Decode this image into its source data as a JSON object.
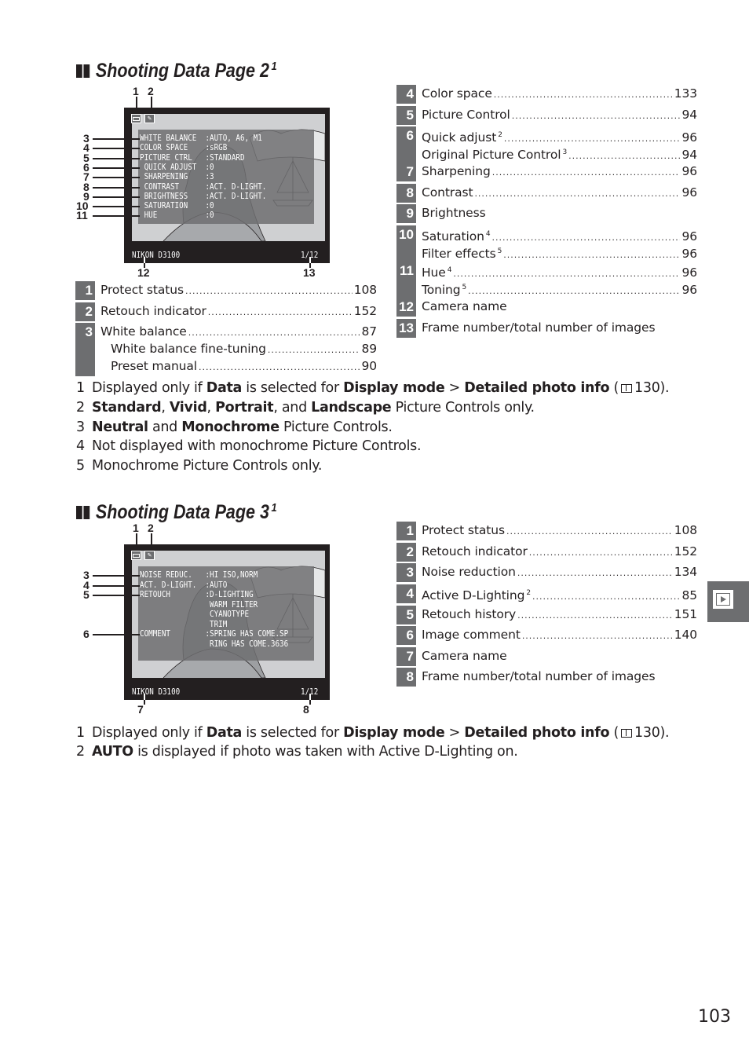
{
  "section2": {
    "title": "Shooting Data Page 2",
    "title_sup": "1",
    "screen": {
      "callouts_top": [
        "1",
        "2"
      ],
      "rows": [
        {
          "n": "3",
          "text": "WHITE BALANCE  :AUTO, A6, M1"
        },
        {
          "n": "4",
          "text": "COLOR SPACE    :sRGB"
        },
        {
          "n": "5",
          "text": "PICTURE CTRL   :STANDARD"
        },
        {
          "n": "6",
          "text": " QUICK ADJUST  :0"
        },
        {
          "n": "7",
          "text": " SHARPENING    :3"
        },
        {
          "n": "8",
          "text": " CONTRAST      :ACT. D-LIGHT."
        },
        {
          "n": "9",
          "text": " BRIGHTNESS    :ACT. D-LIGHT."
        },
        {
          "n": "10",
          "text": " SATURATION    :0"
        },
        {
          "n": "11",
          "text": " HUE           :0"
        }
      ],
      "camera_name": "NIKON D3100",
      "frame": "1/12",
      "callouts_bottom": [
        "12",
        "13"
      ]
    },
    "left_index": [
      {
        "num": "1",
        "lines": [
          {
            "label": "Protect status",
            "sup": "",
            "page": "108"
          }
        ]
      },
      {
        "num": "2",
        "lines": [
          {
            "label": "Retouch indicator",
            "sup": "",
            "page": "152"
          }
        ]
      },
      {
        "num": "3",
        "lines": [
          {
            "label": "White balance",
            "sup": "",
            "page": "87"
          },
          {
            "label": "White balance fine-tuning",
            "sup": "",
            "page": "89",
            "indent": true
          },
          {
            "label": "Preset manual",
            "sup": "",
            "page": "90",
            "indent": true
          }
        ]
      }
    ],
    "right_index": [
      {
        "num": "4",
        "lines": [
          {
            "label": "Color space",
            "sup": "",
            "page": "133"
          }
        ]
      },
      {
        "num": "5",
        "lines": [
          {
            "label": "Picture Control",
            "sup": "",
            "page": "94"
          }
        ]
      },
      {
        "num": "6",
        "lines": [
          {
            "label": "Quick adjust",
            "sup": "2",
            "page": "96"
          },
          {
            "label": "Original Picture Control",
            "sup": "3",
            "page": "94"
          }
        ]
      },
      {
        "num": "7",
        "lines": [
          {
            "label": "Sharpening",
            "sup": "",
            "page": "96"
          }
        ]
      },
      {
        "num": "8",
        "lines": [
          {
            "label": "Contrast",
            "sup": "",
            "page": "96"
          }
        ]
      },
      {
        "num": "9",
        "lines": [
          {
            "label": "Brightness",
            "sup": "",
            "page": ""
          }
        ]
      },
      {
        "num": "10",
        "lines": [
          {
            "label": "Saturation",
            "sup": "4",
            "page": "96"
          },
          {
            "label": "Filter effects",
            "sup": "5",
            "page": "96"
          }
        ]
      },
      {
        "num": "11",
        "lines": [
          {
            "label": "Hue",
            "sup": "4",
            "page": "96"
          },
          {
            "label": "Toning",
            "sup": "5",
            "page": "96"
          }
        ]
      },
      {
        "num": "12",
        "lines": [
          {
            "label": "Camera name",
            "sup": "",
            "page": ""
          }
        ]
      },
      {
        "num": "13",
        "lines": [
          {
            "label": "Frame number/total number of images",
            "sup": "",
            "page": ""
          }
        ]
      }
    ],
    "footnotes": [
      {
        "n": "1",
        "segs": [
          {
            "t": "Displayed only if "
          },
          {
            "t": "Data",
            "b": true
          },
          {
            "t": " is selected for "
          },
          {
            "t": "Display mode",
            "b": true
          },
          {
            "t": " > "
          },
          {
            "t": "Detailed photo info",
            "b": true
          },
          {
            "t": " ("
          },
          {
            "book": true
          },
          {
            "t": "130)."
          }
        ]
      },
      {
        "n": "2",
        "segs": [
          {
            "t": "Standard",
            "b": true
          },
          {
            "t": ", "
          },
          {
            "t": "Vivid",
            "b": true
          },
          {
            "t": ", "
          },
          {
            "t": "Portrait",
            "b": true
          },
          {
            "t": ", and "
          },
          {
            "t": "Landscape",
            "b": true
          },
          {
            "t": " Picture Controls only."
          }
        ]
      },
      {
        "n": "3",
        "segs": [
          {
            "t": "Neutral",
            "b": true
          },
          {
            "t": " and "
          },
          {
            "t": "Monochrome",
            "b": true
          },
          {
            "t": " Picture Controls."
          }
        ]
      },
      {
        "n": "4",
        "segs": [
          {
            "t": "Not displayed with monochrome Picture Controls."
          }
        ]
      },
      {
        "n": "5",
        "segs": [
          {
            "t": "Monochrome Picture Controls only."
          }
        ]
      }
    ]
  },
  "section3": {
    "title": "Shooting Data Page 3",
    "title_sup": "1",
    "screen": {
      "callouts_top": [
        "1",
        "2"
      ],
      "rows": [
        {
          "n": "3",
          "text": "NOISE REDUC.   :HI ISO,NORM"
        },
        {
          "n": "4",
          "text": "ACT. D-LIGHT.  :AUTO"
        },
        {
          "n": "5",
          "text": "RETOUCH        :D-LIGHTING"
        },
        {
          "n": "",
          "text": "                WARM FILTER"
        },
        {
          "n": "",
          "text": "                CYANOTYPE"
        },
        {
          "n": "",
          "text": "                TRIM"
        },
        {
          "n": "6",
          "text": "COMMENT        :SPRING HAS COME.SP"
        },
        {
          "n": "",
          "text": "                RING HAS COME.3636"
        }
      ],
      "camera_name": "NIKON D3100",
      "frame": "1/12",
      "callouts_bottom": [
        "7",
        "8"
      ]
    },
    "right_index": [
      {
        "num": "1",
        "lines": [
          {
            "label": "Protect status",
            "sup": "",
            "page": "108"
          }
        ]
      },
      {
        "num": "2",
        "lines": [
          {
            "label": "Retouch indicator",
            "sup": "",
            "page": "152"
          }
        ]
      },
      {
        "num": "3",
        "lines": [
          {
            "label": "Noise reduction",
            "sup": "",
            "page": "134"
          }
        ]
      },
      {
        "num": "4",
        "lines": [
          {
            "label": "Active D-Lighting",
            "sup": "2",
            "page": "85"
          }
        ]
      },
      {
        "num": "5",
        "lines": [
          {
            "label": "Retouch history",
            "sup": "",
            "page": "151"
          }
        ]
      },
      {
        "num": "6",
        "lines": [
          {
            "label": "Image comment",
            "sup": "",
            "page": "140"
          }
        ]
      },
      {
        "num": "7",
        "lines": [
          {
            "label": "Camera name",
            "sup": "",
            "page": ""
          }
        ]
      },
      {
        "num": "8",
        "lines": [
          {
            "label": "Frame number/total number of images",
            "sup": "",
            "page": ""
          }
        ]
      }
    ],
    "footnotes": [
      {
        "n": "1",
        "segs": [
          {
            "t": "Displayed only if "
          },
          {
            "t": "Data",
            "b": true
          },
          {
            "t": " is selected for "
          },
          {
            "t": "Display mode",
            "b": true
          },
          {
            "t": " > "
          },
          {
            "t": "Detailed photo info",
            "b": true
          },
          {
            "t": " ("
          },
          {
            "book": true
          },
          {
            "t": "130)."
          }
        ]
      },
      {
        "n": "2",
        "segs": [
          {
            "t": "AUTO",
            "b": true
          },
          {
            "t": " is displayed if photo was taken with Active D-Lighting on."
          }
        ]
      }
    ]
  },
  "side_tab_icon": "playback-icon",
  "page_number": "103",
  "colors": {
    "box_gray": "#6d6e70",
    "text": "#231f20"
  }
}
